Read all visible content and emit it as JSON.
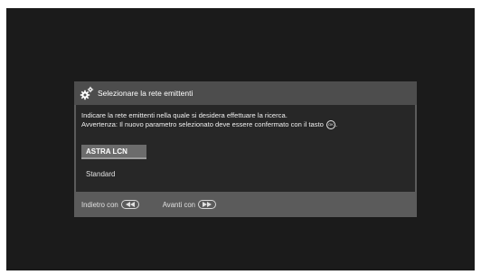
{
  "dialog": {
    "title": "Selezionare la rete emittenti",
    "description_line1": "Indicare la rete emittenti nella quale si desidera effettuare la ricerca.",
    "description_line2": "Avvertenza: Il nuovo parametro selezionato deve essere confermato con il tasto",
    "confirm_key_label": "OK",
    "description_end": ".",
    "options": [
      {
        "label": "ASTRA LCN",
        "selected": true
      },
      {
        "label": "Standard",
        "selected": false
      }
    ],
    "footer": {
      "back_label": "Indietro con",
      "back_key_icon": "rewind-key-icon",
      "forward_label": "Avanti con",
      "forward_key_icon": "fast-forward-key-icon"
    }
  },
  "colors": {
    "screen_background": "#1b1b1b",
    "dialog_background": "#5b5b5b",
    "dialog_header": "#4d4d4d",
    "dialog_body": "#272727",
    "selected_option": "#6c6c6c"
  }
}
